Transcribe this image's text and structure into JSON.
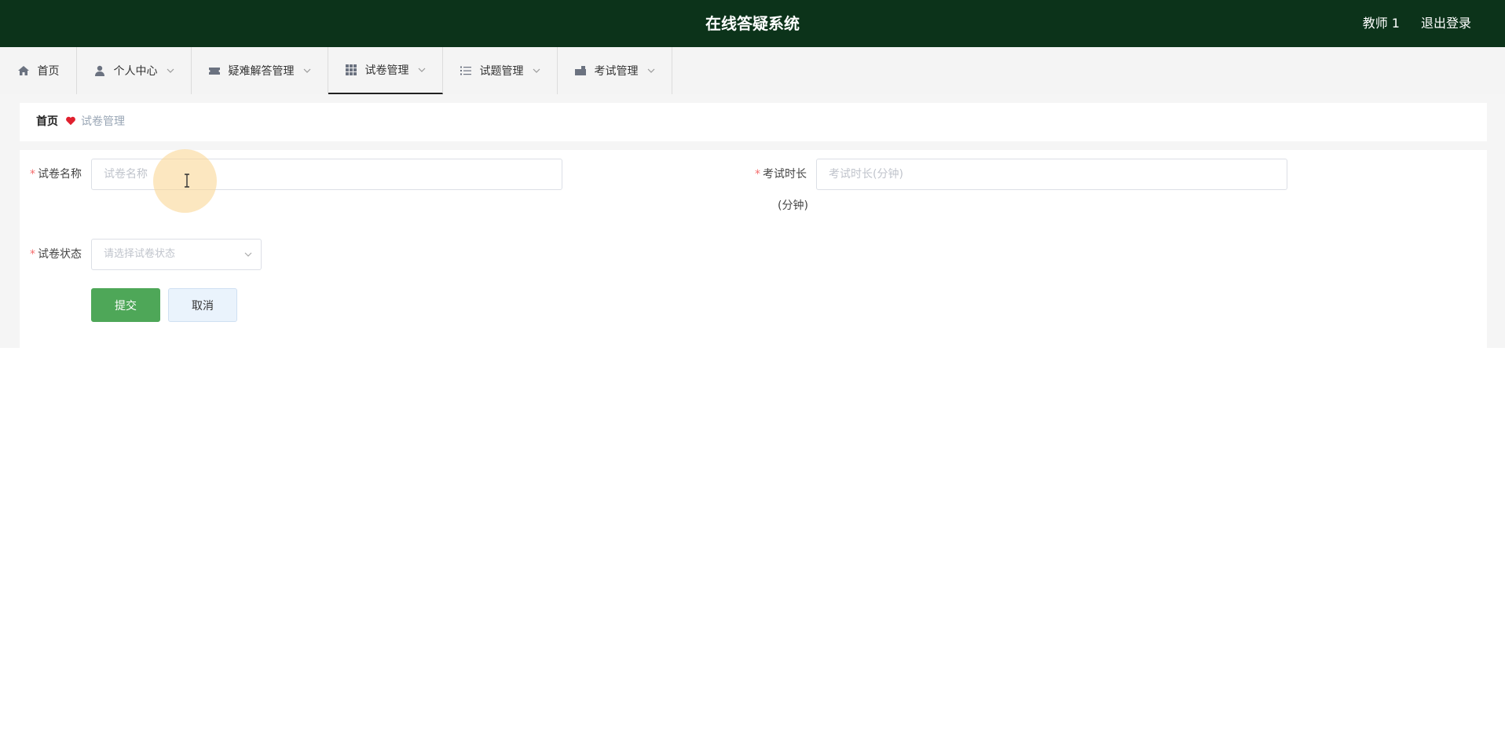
{
  "header": {
    "title": "在线答疑系统",
    "user": "教师 1",
    "logout": "退出登录"
  },
  "nav": {
    "items": [
      {
        "label": "首页",
        "icon": "home-icon",
        "has_dropdown": false
      },
      {
        "label": "个人中心",
        "icon": "user-icon",
        "has_dropdown": true
      },
      {
        "label": "疑难解答管理",
        "icon": "ticket-icon",
        "has_dropdown": true
      },
      {
        "label": "试卷管理",
        "icon": "grid-icon",
        "has_dropdown": true,
        "active": true
      },
      {
        "label": "试题管理",
        "icon": "list-icon",
        "has_dropdown": true
      },
      {
        "label": "考试管理",
        "icon": "briefcase-icon",
        "has_dropdown": true
      }
    ]
  },
  "breadcrumb": {
    "home": "首页",
    "current": "试卷管理",
    "separator_icon": "heart-icon",
    "separator_color": "#e0202e"
  },
  "form": {
    "paper_name": {
      "label": "试卷名称",
      "placeholder": "试卷名称",
      "value": ""
    },
    "duration": {
      "label": "考试时长",
      "label_suffix": "(分钟)",
      "placeholder": "考试时长(分钟)",
      "value": ""
    },
    "status": {
      "label": "试卷状态",
      "placeholder": "请选择试卷状态"
    },
    "submit_label": "提交",
    "cancel_label": "取消"
  },
  "colors": {
    "header_bg": "#0c331a",
    "submit_bg": "#4ea758",
    "required": "#f56c6c"
  }
}
